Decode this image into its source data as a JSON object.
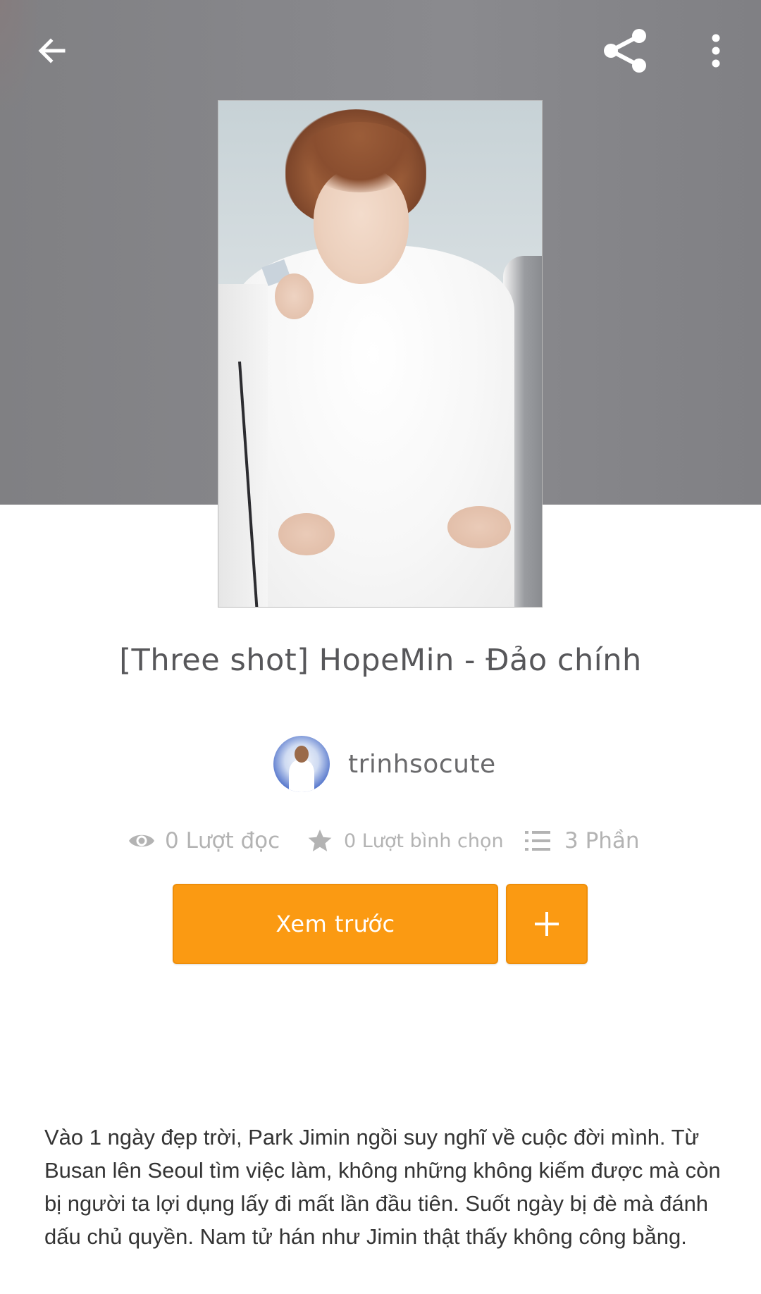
{
  "story": {
    "title": "[Three shot] HopeMin - Đảo chính",
    "author": "trinhsocute",
    "stats": {
      "reads": "0 Lượt đọc",
      "votes": "0 Lượt bình chọn",
      "parts": "3 Phần"
    },
    "description": "Vào 1 ngày đẹp trời, Park Jimin ngồi suy nghĩ về cuộc đời mình. Từ Busan lên Seoul tìm việc làm, không những không kiếm được mà còn bị người ta lợi dụng lấy đi mất lần đầu tiên. Suốt ngày bị đè mà đánh dấu chủ quyền. Nam tử hán như Jimin thật thấy không công bằng."
  },
  "actions": {
    "preview_label": "Xem trước",
    "add_label": "+"
  },
  "toolbar": {
    "back_icon": "arrow-left-icon",
    "share_icon": "share-icon",
    "more_icon": "more-vertical-icon"
  },
  "colors": {
    "accent": "#fb9a12",
    "header_bg": "#86868a",
    "stat_text": "#b3b3b3",
    "title_text": "#57575a"
  }
}
